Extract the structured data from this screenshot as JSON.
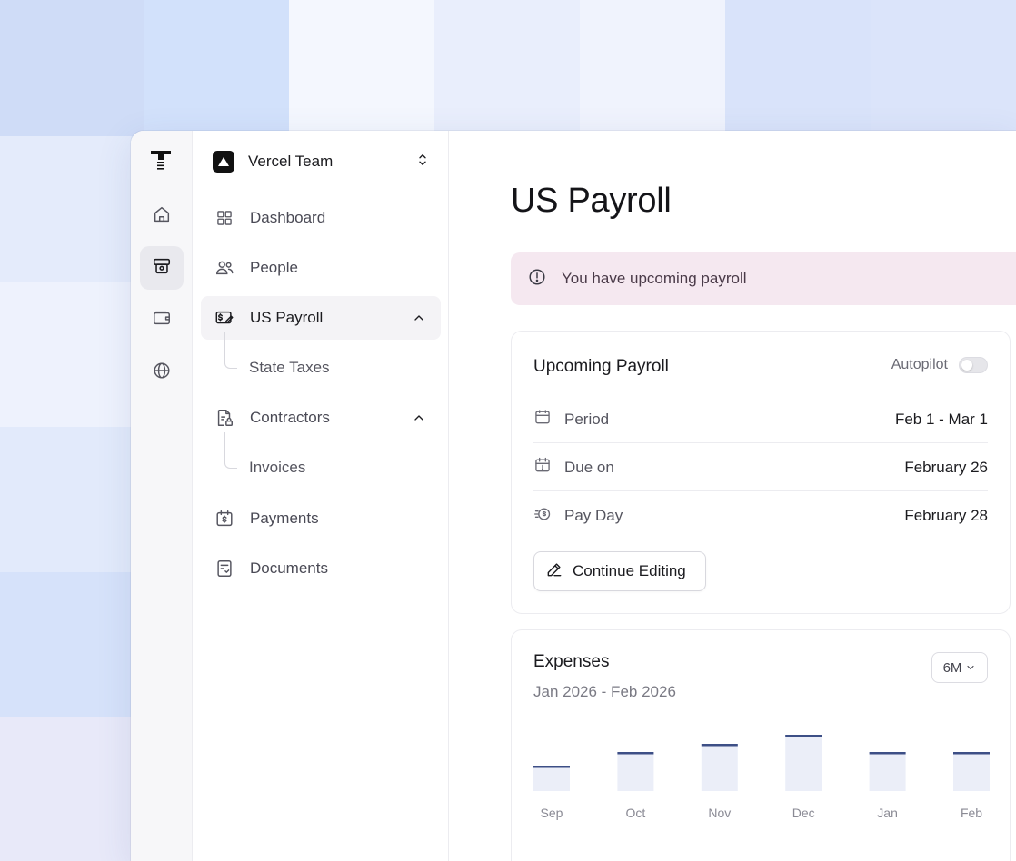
{
  "team": {
    "name": "Vercel Team"
  },
  "nav": {
    "items": [
      {
        "label": "Dashboard"
      },
      {
        "label": "People"
      },
      {
        "label": "US Payroll"
      },
      {
        "label": "State Taxes"
      },
      {
        "label": "Contractors"
      },
      {
        "label": "Invoices"
      },
      {
        "label": "Payments"
      },
      {
        "label": "Documents"
      }
    ]
  },
  "page": {
    "title": "US Payroll"
  },
  "alert": {
    "text": "You have upcoming payroll"
  },
  "upcoming": {
    "title": "Upcoming Payroll",
    "autopilot_label": "Autopilot",
    "autopilot_on": false,
    "rows": [
      {
        "label": "Period",
        "value": "Feb 1 - Mar 1",
        "icon": "calendar-icon"
      },
      {
        "label": "Due on",
        "value": "February 26",
        "icon": "calendar-alert-icon"
      },
      {
        "label": "Pay Day",
        "value": "February 28",
        "icon": "coin-icon"
      }
    ],
    "edit_label": "Continue Editing"
  },
  "expenses": {
    "title": "Expenses",
    "range": "Jan 2026 - Feb 2026",
    "period": "6M"
  },
  "colors": {
    "accent": "#3d4f86",
    "bar_fill": "#ebeef8",
    "alert_bg": "#f5e8f0"
  },
  "chart_data": {
    "type": "bar",
    "categories": [
      "Sep",
      "Oct",
      "Nov",
      "Dec",
      "Jan",
      "Feb"
    ],
    "values": [
      28,
      43,
      52,
      62,
      43,
      43
    ],
    "ylim": [
      0,
      70
    ],
    "grid": false,
    "legend": "none"
  }
}
